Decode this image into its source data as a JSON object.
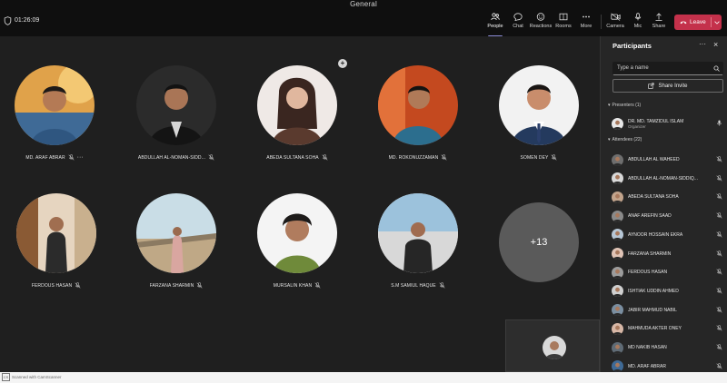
{
  "window": {
    "title": "General",
    "timer": "01:26:09"
  },
  "toolbar": {
    "items": [
      {
        "label": "People",
        "icon": "people-icon",
        "active": true
      },
      {
        "label": "Chat",
        "icon": "chat-icon"
      },
      {
        "label": "Reactions",
        "icon": "reactions-icon"
      },
      {
        "label": "Rooms",
        "icon": "rooms-icon"
      },
      {
        "label": "More",
        "icon": "more-icon"
      },
      {
        "label": "Camera",
        "icon": "camera-icon"
      },
      {
        "label": "Mic",
        "icon": "mic-icon"
      },
      {
        "label": "Share",
        "icon": "share-icon"
      }
    ],
    "leave_label": "Leave",
    "leave_color": "#c4314b"
  },
  "stage": {
    "tiles": [
      {
        "name": "MD. ARAF ABRAR",
        "more": "···"
      },
      {
        "name": "ABDULLAH AL-NOMAN-SIDD..."
      },
      {
        "name": "ABEDA SULTANA SOHA"
      },
      {
        "name": "MD. ROKONUZZAMAN"
      },
      {
        "name": "SOMEN DEY"
      },
      {
        "name": "FERDOUS HASAN"
      },
      {
        "name": "FARZANA SHARMIN"
      },
      {
        "name": "MURSALIN KHAN"
      },
      {
        "name": "S.M SAMIUL HAQUE"
      }
    ],
    "overflow_count": "+13"
  },
  "panel": {
    "title": "Participants",
    "more": "···",
    "close": "×",
    "search_placeholder": "Type a name",
    "share_invite": "Share Invite",
    "presenters_label": "Presenters (1)",
    "attendees_label": "Attendees (22)",
    "presenter": {
      "name": "DR. MD. TAMZIDUL ISLAM",
      "role": "Organizer"
    },
    "attendees": [
      "ABDULLAH AL WAHEED",
      "ABDULLAH AL-NOMAN-SIDDIQ...",
      "ABEDA SULTANA SOHA",
      "ANAF AREFIN SAAD",
      "AYNOOR HOSSAIN EKRA",
      "FARZANA SHARMIN",
      "FERDOUS HASAN",
      "ISHTIAK UDDIN AHMED",
      "JABIR MAHMUD NABIL",
      "MAHMUDA AKTER ONEY",
      "MD NAKIB HASAN",
      "MD. ARAF ABRAR"
    ]
  },
  "footer": {
    "scanner_text": "Scanned with CamScanner",
    "scanner_logo": "CS"
  }
}
